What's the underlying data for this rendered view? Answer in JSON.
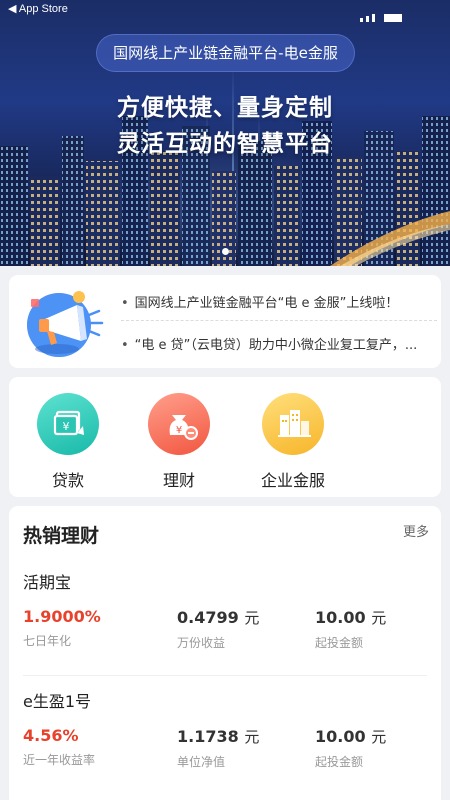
{
  "statusbar": {
    "carrier": "◀ App Store"
  },
  "hero": {
    "pill": "国网线上产业链金融平台-电e金服",
    "line1": "方便快捷、量身定制",
    "line2": "灵活互动的智慧平台"
  },
  "news": {
    "items": [
      "国网线上产业链金融平台“电 e 金服”上线啦！",
      "“电 e 贷”（云电贷）助力中小微企业复工复产，..."
    ]
  },
  "services": [
    {
      "label": "贷款",
      "icon": "loan-icon"
    },
    {
      "label": "理财",
      "icon": "money-bag-icon"
    },
    {
      "label": "企业金服",
      "icon": "building-icon"
    }
  ],
  "products": {
    "title": "热销理财",
    "more": "更多",
    "items": [
      {
        "name": "活期宝",
        "rate": "1.9000%",
        "rate_label": "七日年化",
        "mid_value": "0.4799",
        "mid_unit": "元",
        "mid_label": "万份收益",
        "min_value": "10.00",
        "min_unit": "元",
        "min_label": "起投金额"
      },
      {
        "name": "e生盈1号",
        "rate": "4.56%",
        "rate_label": "近一年收益率",
        "mid_value": "1.1738",
        "mid_unit": "元",
        "mid_label": "单位净值",
        "min_value": "10.00",
        "min_unit": "元",
        "min_label": "起投金额"
      }
    ]
  },
  "colors": {
    "accent_red": "#e8412c",
    "loan": "#18b9a9",
    "finance": "#f2563f",
    "enterprise": "#f7b529"
  }
}
